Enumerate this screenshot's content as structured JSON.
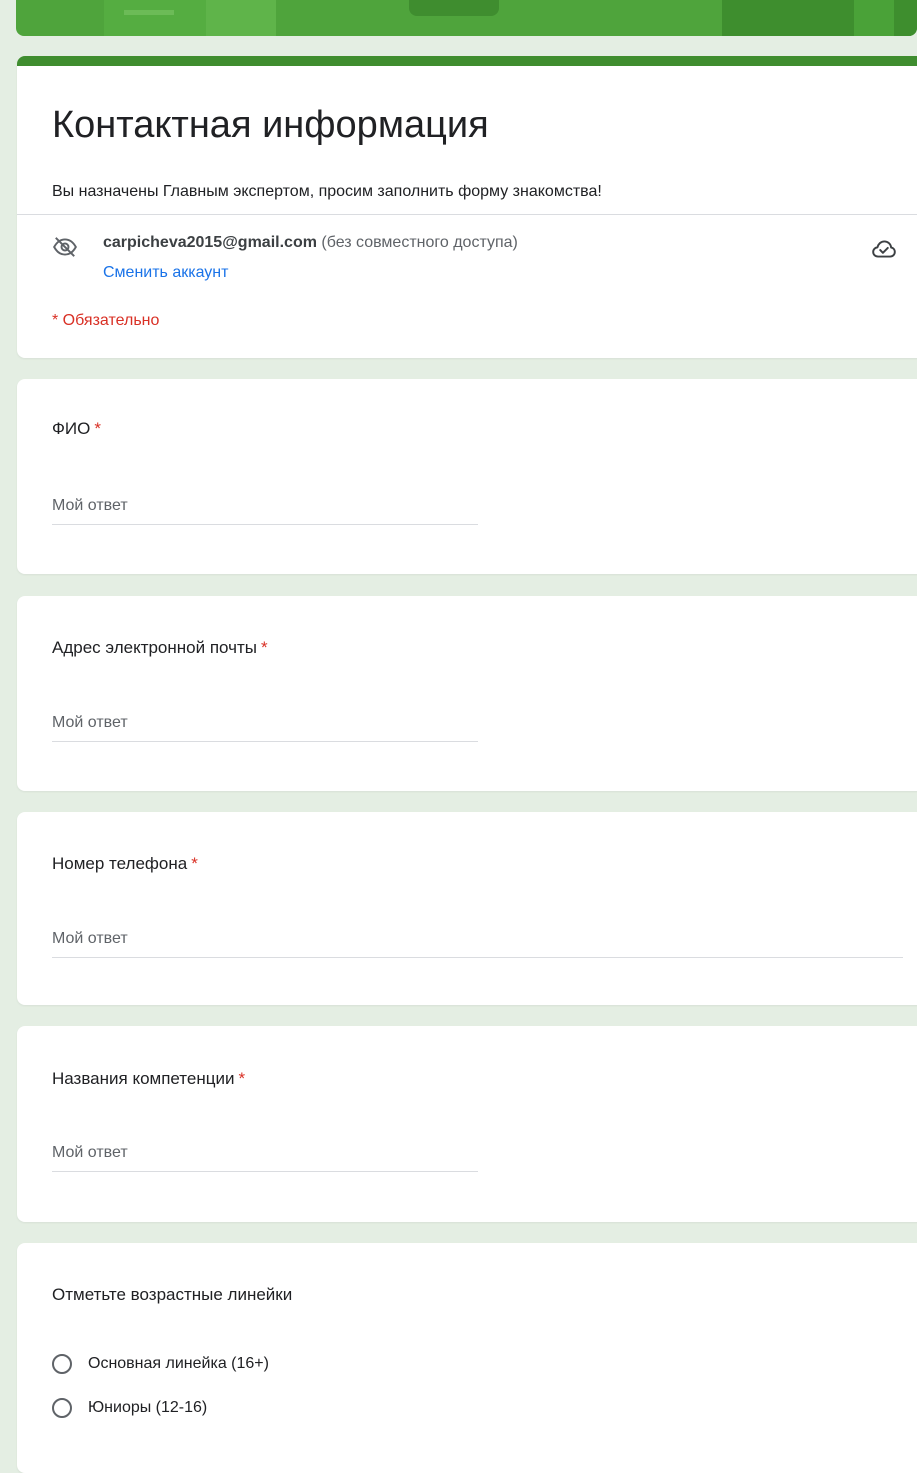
{
  "colors": {
    "theme": "#3f8d2f",
    "background": "#e4eee3",
    "link": "#1a73e8",
    "required": "#d93025"
  },
  "header": {
    "title": "Контактная информация",
    "description": "Вы назначены Главным экспертом, просим заполнить форму знакомства!",
    "account": {
      "email": "carpicheva2015@gmail.com",
      "sharing_note": "(без совместного доступа)",
      "switch_label": "Сменить аккаунт",
      "privacy_icon": "eye-off-icon",
      "save_status_icon": "cloud-check-icon"
    },
    "required_note": "* Обязательно"
  },
  "questions": [
    {
      "title": "ФИО",
      "required_mark": "*",
      "placeholder": "Мой ответ"
    },
    {
      "title": "Адрес электронной почты",
      "required_mark": "*",
      "placeholder": "Мой ответ"
    },
    {
      "title": "Номер телефона",
      "required_mark": "*",
      "placeholder": "Мой ответ"
    },
    {
      "title": "Названия компетенции",
      "required_mark": "*",
      "placeholder": "Мой ответ"
    }
  ],
  "age_question": {
    "title": "Отметьте возрастные линейки",
    "options": [
      {
        "label": "Основная линейка (16+)",
        "selected": false
      },
      {
        "label": "Юниоры (12-16)",
        "selected": false
      }
    ]
  }
}
